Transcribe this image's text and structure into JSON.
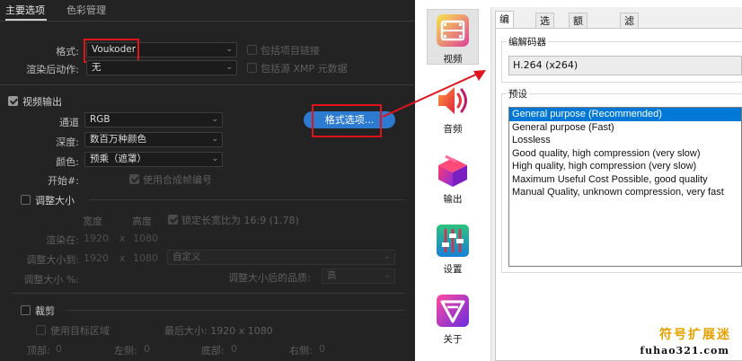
{
  "export": {
    "tabs": [
      "主要选项",
      "色彩管理"
    ],
    "format_label": "格式:",
    "format_value": "Voukoder",
    "include_chain_label": "包括项目链接",
    "post_action_label": "渲染后动作:",
    "post_action_value": "无",
    "include_xmp_label": "包括源 XMP 元数据",
    "video_output_label": "视频输出",
    "channel_label": "通道",
    "channel_value": "RGB",
    "depth_label": "深度:",
    "depth_value": "数百万种颜色",
    "color_label": "颜色:",
    "color_value": "预乘（遮罩）",
    "format_options_button": "格式选项...",
    "start_label": "开始#:",
    "composite_frame_label": "使用合成帧编号",
    "resize_label": "调整大小",
    "width_label": "宽度",
    "height_label": "高度",
    "lock_ratio_label": "锁定长宽比为 16:9 (1.78)",
    "render_at_label": "渲染在:",
    "render_width": "1920",
    "render_height": "1080",
    "x_sep": "x",
    "resize_to_label": "调整大小到:",
    "resize_width": "1920",
    "resize_height": "1080",
    "resize_preset_value": "自定义",
    "resize_pct_label": "调整大小 %:",
    "quality_label": "调整大小后的品质:",
    "quality_value": "高",
    "crop_label": "裁剪",
    "use_region_label": "使用目标区域",
    "final_size_label": "最后大小: 1920 x 1080",
    "top_label": "顶部:",
    "top_value": "0",
    "left_label": "左侧:",
    "left_value": "0",
    "bottom_label": "底部:",
    "bottom_value": "0",
    "right_label": "右侧:",
    "right_value": "0"
  },
  "voukoder": {
    "sidebar": [
      {
        "label": "视频",
        "icon": "video-film-icon"
      },
      {
        "label": "音频",
        "icon": "audio-speaker-icon"
      },
      {
        "label": "输出",
        "icon": "output-box-icon"
      },
      {
        "label": "设置",
        "icon": "settings-sliders-icon"
      },
      {
        "label": "关于",
        "icon": "about-logo-icon"
      }
    ],
    "tabs": [
      "编码器",
      "选项",
      "额外数据",
      "滤镜"
    ],
    "codec_group_label": "编解码器",
    "codec_value": "H.264 (x264)",
    "preset_group_label": "预设",
    "presets": [
      "General purpose (Recommended)",
      "General purpose (Fast)",
      "Lossless",
      "Good quality, high compression (very slow)",
      "High quality, high compression (very slow)",
      "Maximum Useful Cost Possible, good quality",
      "Manual Quality, unknown compression, very fast"
    ],
    "selected_preset_index": 0
  },
  "watermark": {
    "line1": "符号扩展迷",
    "line2": "fuhao321.com"
  },
  "colors": {
    "accent_blue": "#2d7ad1",
    "highlight_red": "#e0141c",
    "selection_blue": "#0078d7"
  }
}
